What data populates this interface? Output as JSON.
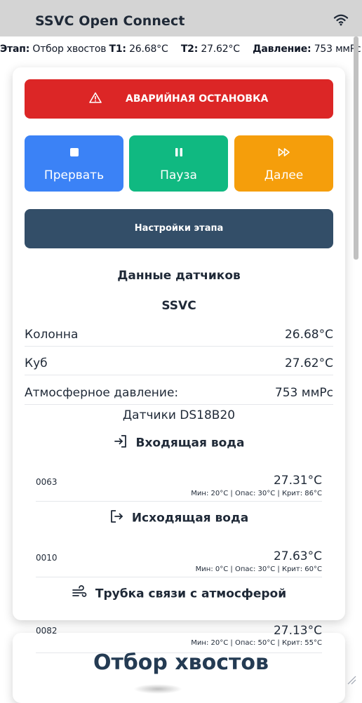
{
  "header": {
    "title": "SSVC Open Connect",
    "wifi_icon": "wifi-icon"
  },
  "status": {
    "stage_label": "Этап:",
    "stage_value": "Отбор хвостов",
    "t1_label": "T1:",
    "t1_value": "26.68°C",
    "t2_label": "T2:",
    "t2_value": "27.62°C",
    "pressure_label": "Давление:",
    "pressure_value": "753 ммРс"
  },
  "controls": {
    "emergency_label": "АВАРИЙНАЯ ОСТАНОВКА",
    "stop_label": "Прервать",
    "pause_label": "Пауза",
    "next_label": "Далее",
    "settings_label": "Настройки этапа",
    "colors": {
      "emergency": "#dc2626",
      "stop": "#3b82f6",
      "pause": "#10b981",
      "next": "#f59e0b",
      "settings": "#334e68"
    }
  },
  "sensors": {
    "heading": "Данные датчиков",
    "group_title": "SSVC",
    "rows": [
      {
        "label": "Колонна",
        "value": "26.68°C"
      },
      {
        "label": "Куб",
        "value": "27.62°C"
      },
      {
        "label": "Атмосферное давление:",
        "value": "753 ммРс"
      }
    ],
    "ds_title": "Датчики DS18B20",
    "groups": [
      {
        "title": "Входящая вода",
        "icon": "sign-in-icon",
        "id": "0063",
        "temp": "27.31°C",
        "limits": "Мин: 20°C | Опас: 30°C | Крит: 86°C"
      },
      {
        "title": "Исходящая вода",
        "icon": "sign-out-icon",
        "id": "0010",
        "temp": "27.63°C",
        "limits": "Мин: 0°C | Опас: 30°C | Крит: 60°C"
      },
      {
        "title": "Трубка связи с атмосферой",
        "icon": "wind-icon",
        "id": "0082",
        "temp": "27.13°C",
        "limits": "Мин: 20°C | Опас: 50°C | Крит: 55°C"
      }
    ]
  },
  "stage_title": "Отбор хвостов"
}
